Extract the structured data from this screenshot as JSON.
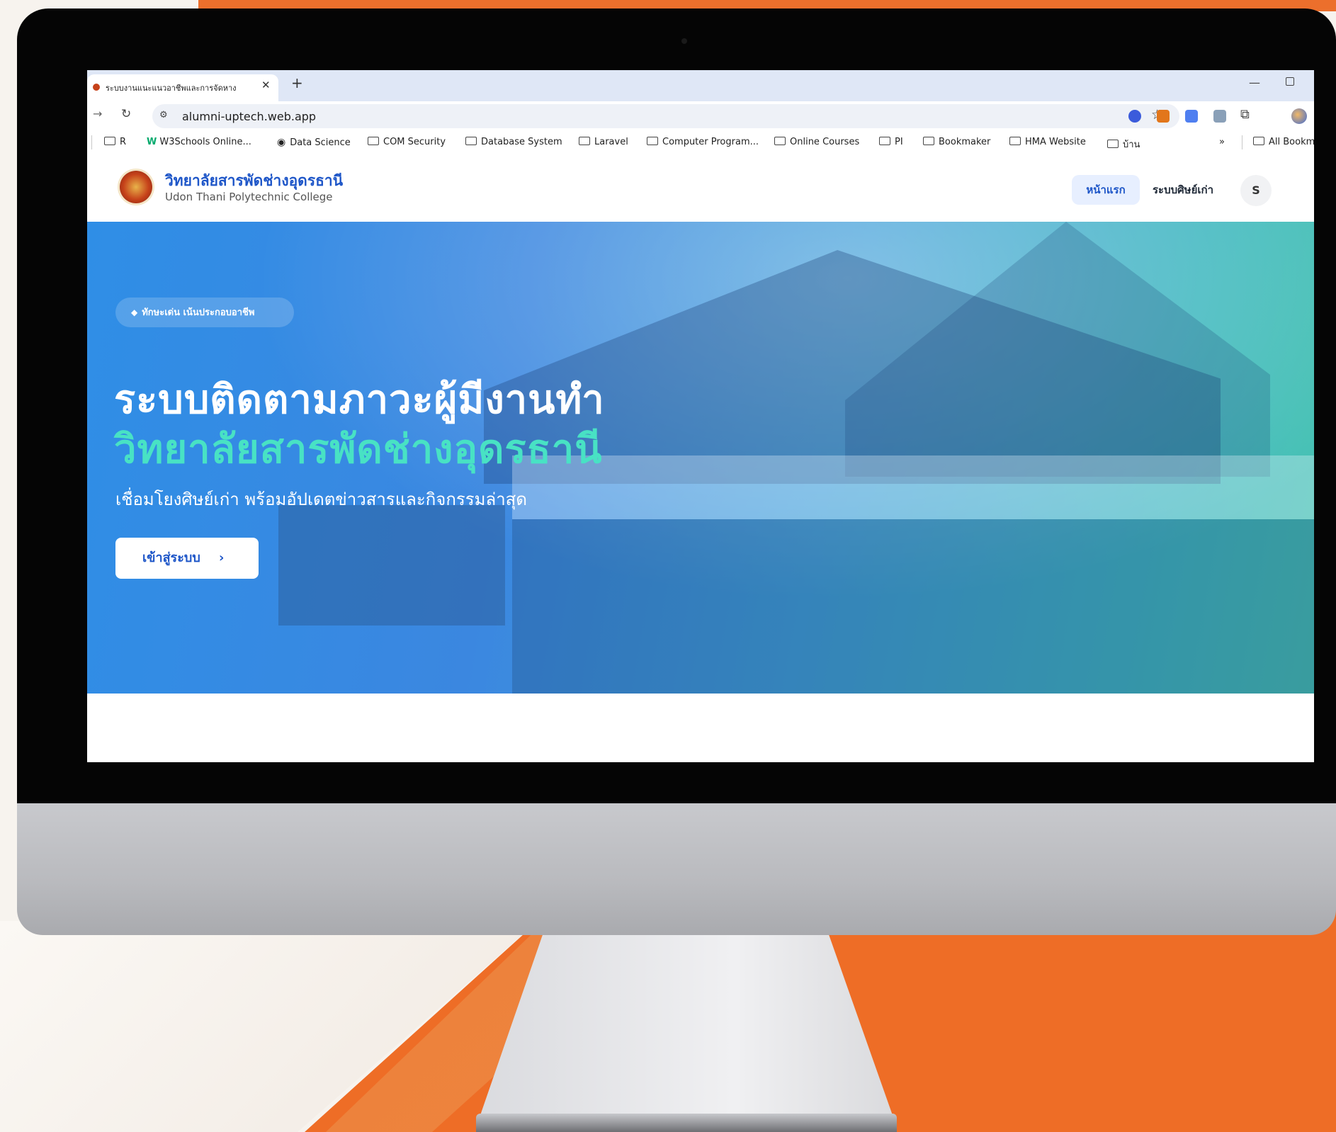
{
  "browser": {
    "tab_title": "ระบบงานแนะแนวอาชีพและการจัดหาง",
    "tab_close": "✕",
    "new_tab": "+",
    "url": "alumni-uptech.web.app",
    "window_minimize": "—",
    "bookmarks": [
      {
        "label": "R",
        "icon": "folder-icon"
      },
      {
        "label": "W3Schools Online...",
        "icon": "w3schools-icon"
      },
      {
        "label": "Data Science",
        "icon": "globe-icon"
      },
      {
        "label": "COM Security",
        "icon": "folder-icon"
      },
      {
        "label": "Database System",
        "icon": "folder-icon"
      },
      {
        "label": "Laravel",
        "icon": "folder-icon"
      },
      {
        "label": "Computer Program...",
        "icon": "folder-icon"
      },
      {
        "label": "Online Courses",
        "icon": "folder-icon"
      },
      {
        "label": "PI",
        "icon": "folder-icon"
      },
      {
        "label": "Bookmaker",
        "icon": "folder-icon"
      },
      {
        "label": "HMA Website",
        "icon": "folder-icon"
      },
      {
        "label": "บ้าน",
        "icon": "folder-icon"
      }
    ],
    "bookmarks_overflow": "»",
    "all_bookmarks": "All Bookm"
  },
  "site": {
    "brand_th": "วิทยาลัยสารพัดช่างอุดรธานี",
    "brand_en": "Udon Thani Polytechnic College",
    "nav": {
      "home": "หน้าแรก",
      "alumni_system": "ระบบศิษย์เก่า",
      "avatar_initial": "S"
    }
  },
  "hero": {
    "badge": "ทักษะเด่น เน้นประกอบอาชีพ",
    "title_line_1": "ระบบติดตามภาวะผู้มีงานทำ",
    "title_line_2": "วิทยาลัยสารพัดช่างอุดรธานี",
    "subtitle": "เชื่อมโยงศิษย์เก่า พร้อมอัปเดตข่าวสารและกิจกรรมล่าสุด",
    "cta_label": "เข้าสู่ระบบ",
    "cta_arrow": "›"
  },
  "colors": {
    "accent_blue": "#1e56c8",
    "accent_teal": "#48e2c4",
    "background_orange": "#ee6d26"
  }
}
